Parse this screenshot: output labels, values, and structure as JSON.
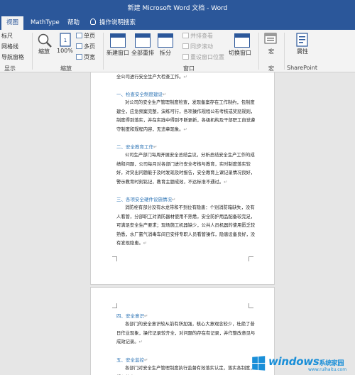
{
  "window": {
    "title": "新建 Microsoft Word 文档 - Word"
  },
  "tabs": [
    {
      "label": "视图",
      "active": true
    },
    {
      "label": "MathType",
      "active": false
    },
    {
      "label": "帮助",
      "active": false
    },
    {
      "label": "操作说明搜索",
      "active": false
    }
  ],
  "ribbon": {
    "show": {
      "items": [
        "标尺",
        "网格线",
        "导航窗格"
      ],
      "label": "显示"
    },
    "zoom": {
      "zoom_label": "缩放",
      "percent_label": "100%",
      "one_page": "单页",
      "multi_page": "多页",
      "page_width": "页宽",
      "label": "缩放"
    },
    "window": {
      "new_window": "新建窗口",
      "arrange_all": "全部重排",
      "split": "拆分",
      "side_by_side": "并排查看",
      "sync_scroll": "同步滚动",
      "reset_position": "重设窗口位置",
      "switch_windows": "切换窗口",
      "label": "窗口"
    },
    "macros": {
      "button": "宏",
      "label": "宏"
    },
    "sharepoint": {
      "button": "属性",
      "label": "SharePoint"
    }
  },
  "doc": {
    "p0": "全公司进行安全生产大检查工作。",
    "h4": "一、检查安全制度建设",
    "p4": "对公司的安全生产管理制度检查，发现备案存在工作制约，包制度建全，应急预案完整，演练可行，各项操作规程公布考核或奖惩规则，制度得到落实，并在实践中得到不断更新，各级机构及干部职工自觉遵守制度和规程内容，无违章现象。",
    "h2": "二、安全教育工作",
    "p2": "公司生产部门每周开展安全总结会议，分析总结安全生产工作的成绩和问题，公司每月对各部门进行安全考核与教育，实时制度落实较好，对突出问题能于及时发现及时报告，安全教育上课记录情况良好，警示教育时刻铭记，教育主题成效，不达标准不通过。",
    "h3": "三、各项安全硬件设施情况",
    "p3": "消防栓有部分没有水龙带和不到位有隐患：个别消防箱缺失，没有人看管，分部职工对消防器材使用不熟悉，安全防护用品配备较完足，可满足安全生产要求；现场施工机器缺少，公共人员机器的使用匮乏较熟悉，水厂氯气消毒车间已安排专职人员看管操作，隐患设备良好，没有发现隐患。",
    "h5": "四、安全意识",
    "p5": "各部门的安全意识较从前有所加强，核心大意观念较少，杜绝了昔日作业现象，操作记录较齐全，对问题的存在有记录，并作整改意见与成效记录。",
    "h6": "五、安全监控",
    "p6": "各部门对安全生产管理制度执行监督有效落实认定，落实各制度，规程的自"
  },
  "watermark": {
    "brand": "windows",
    "suffix": "系统家园",
    "url": "www.ruihaitu.com"
  }
}
